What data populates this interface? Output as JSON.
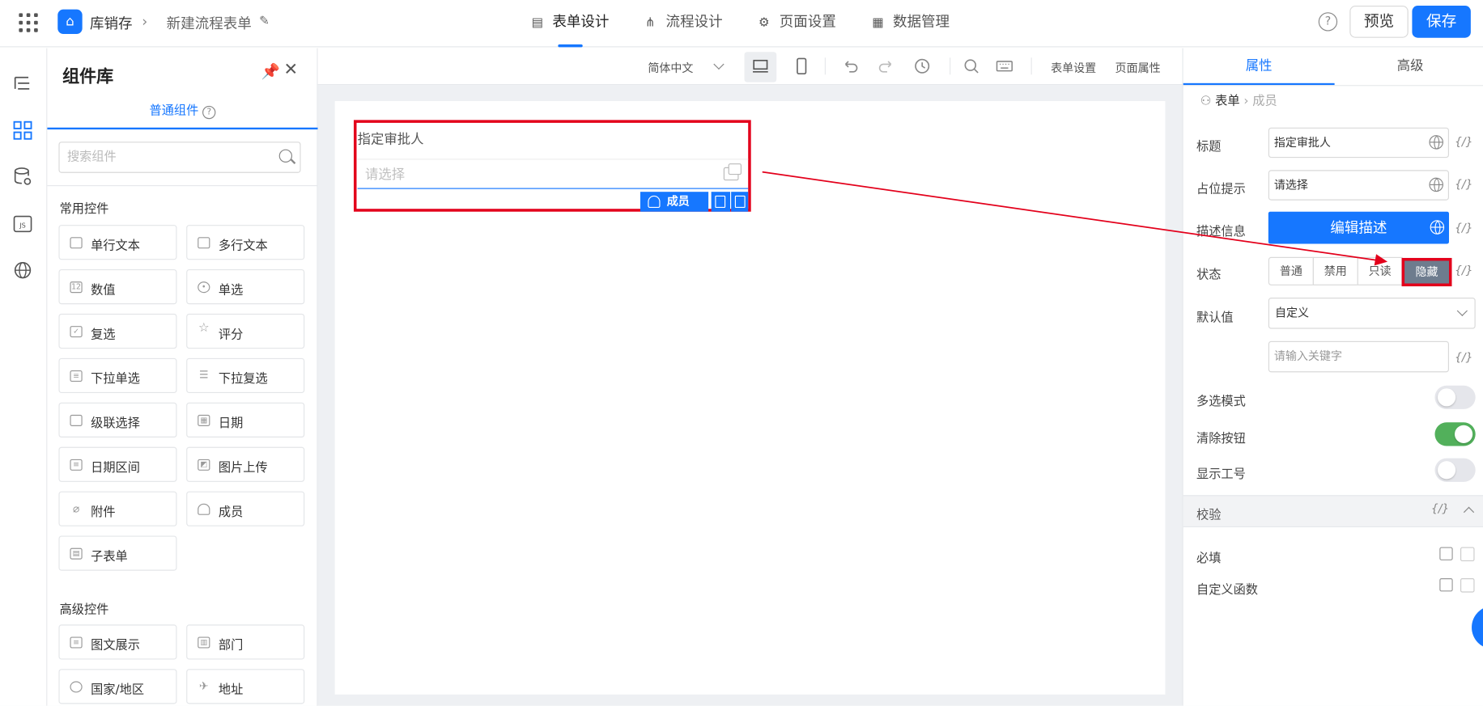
{
  "header": {
    "app_name": "库销存",
    "form_name": "新建流程表单",
    "tabs": [
      {
        "label": "表单设计",
        "icon": "document-icon"
      },
      {
        "label": "流程设计",
        "icon": "flow-icon"
      },
      {
        "label": "页面设置",
        "icon": "gear-icon"
      },
      {
        "label": "数据管理",
        "icon": "table-icon"
      }
    ],
    "help": "?",
    "preview_label": "预览",
    "save_label": "保存"
  },
  "component_library": {
    "title": "组件库",
    "subtab": "普通组件",
    "search_placeholder": "搜索组件",
    "common_section": "常用控件",
    "common_items": [
      "单行文本",
      "多行文本",
      "数值",
      "单选",
      "复选",
      "评分",
      "下拉单选",
      "下拉复选",
      "级联选择",
      "日期",
      "日期区间",
      "图片上传",
      "附件",
      "成员",
      "子表单"
    ],
    "advanced_section": "高级控件",
    "advanced_items": [
      "图文展示",
      "部门",
      "国家/地区",
      "地址"
    ]
  },
  "canvas_toolbar": {
    "language": "简体中文",
    "form_settings": "表单设置",
    "page_props": "页面属性"
  },
  "canvas": {
    "field_label": "指定审批人",
    "field_placeholder": "请选择",
    "field_tag": "成员"
  },
  "properties": {
    "tabs": [
      "属性",
      "高级"
    ],
    "breadcrumb": [
      "表单",
      "成员"
    ],
    "title_label": "标题",
    "title_value": "指定审批人",
    "placeholder_label": "占位提示",
    "placeholder_value": "请选择",
    "desc_label": "描述信息",
    "desc_button": "编辑描述",
    "status_label": "状态",
    "status_options": [
      "普通",
      "禁用",
      "只读",
      "隐藏"
    ],
    "status_selected": "隐藏",
    "default_label": "默认值",
    "default_value": "自定义",
    "keyword_placeholder": "请输入关键字",
    "multi_label": "多选模式",
    "multi_on": false,
    "clear_label": "清除按钮",
    "clear_on": true,
    "jobno_label": "显示工号",
    "jobno_on": false,
    "expr_label": "{/}",
    "validation_title": "校验",
    "required_label": "必填",
    "custom_fn_label": "自定义函数"
  },
  "colors": {
    "accent": "#1677ff",
    "highlight": "#e3001b",
    "toggle_on": "#52b05b"
  }
}
